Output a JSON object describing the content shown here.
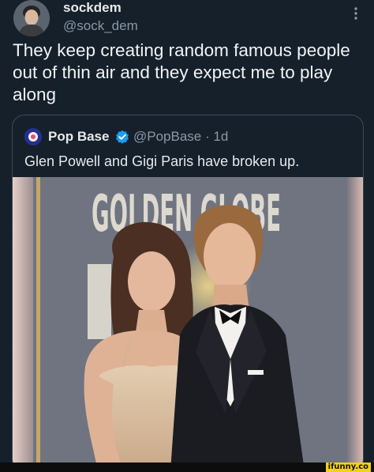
{
  "tweet": {
    "display_name": "sockdem",
    "handle": "@sock_dem",
    "text": "They keep creating random famous people out of thin air and they expect me to play along"
  },
  "quoted_tweet": {
    "display_name": "Pop Base",
    "handle_and_time": "@PopBase · 1d",
    "text": "Glen Powell and Gigi Paris have broken up.",
    "verified_color": "#1d9bf0"
  },
  "photo": {
    "backdrop_lettering": "GOLDEN GLOBE"
  },
  "watermark": {
    "label": "ifunny.co"
  },
  "colors": {
    "background": "#15202b",
    "text_primary": "#e7e9ea",
    "text_secondary": "#8b98a5",
    "card_border": "#3a4a5a",
    "watermark_yellow": "#f5d21a"
  }
}
